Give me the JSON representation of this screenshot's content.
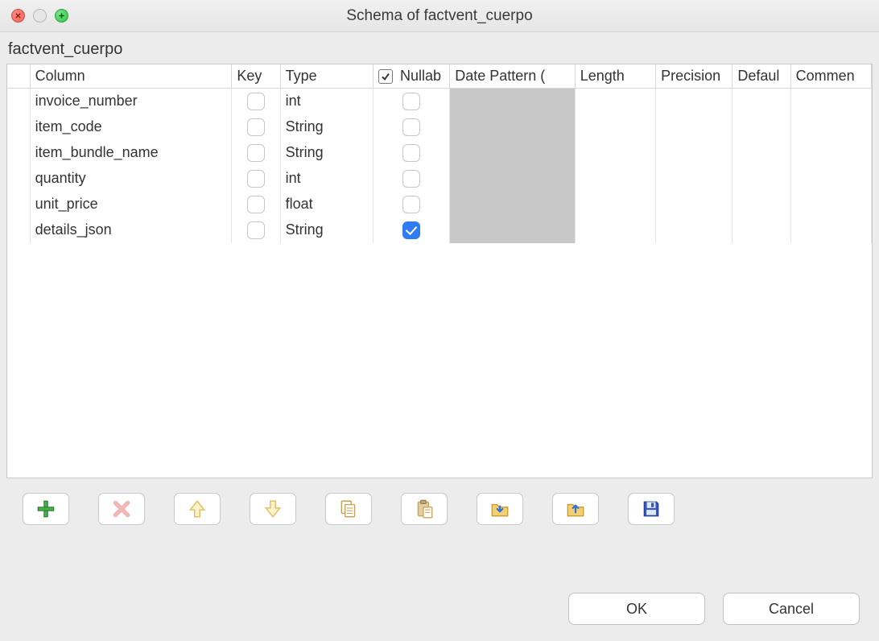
{
  "window": {
    "title": "Schema of factvent_cuerpo"
  },
  "schemaName": "factvent_cuerpo",
  "headers": {
    "column": "Column",
    "key": "Key",
    "type": "Type",
    "nullable": "Nullab",
    "datePattern": "Date Pattern (",
    "length": "Length",
    "precision": "Precision",
    "default": "Defaul",
    "comment": "Commen"
  },
  "rows": [
    {
      "column": "invoice_number",
      "key": false,
      "type": "int",
      "nullable": false
    },
    {
      "column": "item_code",
      "key": false,
      "type": "String",
      "nullable": false
    },
    {
      "column": "item_bundle_name",
      "key": false,
      "type": "String",
      "nullable": false
    },
    {
      "column": "quantity",
      "key": false,
      "type": "int",
      "nullable": false
    },
    {
      "column": "unit_price",
      "key": false,
      "type": "float",
      "nullable": false
    },
    {
      "column": "details_json",
      "key": false,
      "type": "String",
      "nullable": true
    }
  ],
  "buttons": {
    "ok": "OK",
    "cancel": "Cancel"
  }
}
